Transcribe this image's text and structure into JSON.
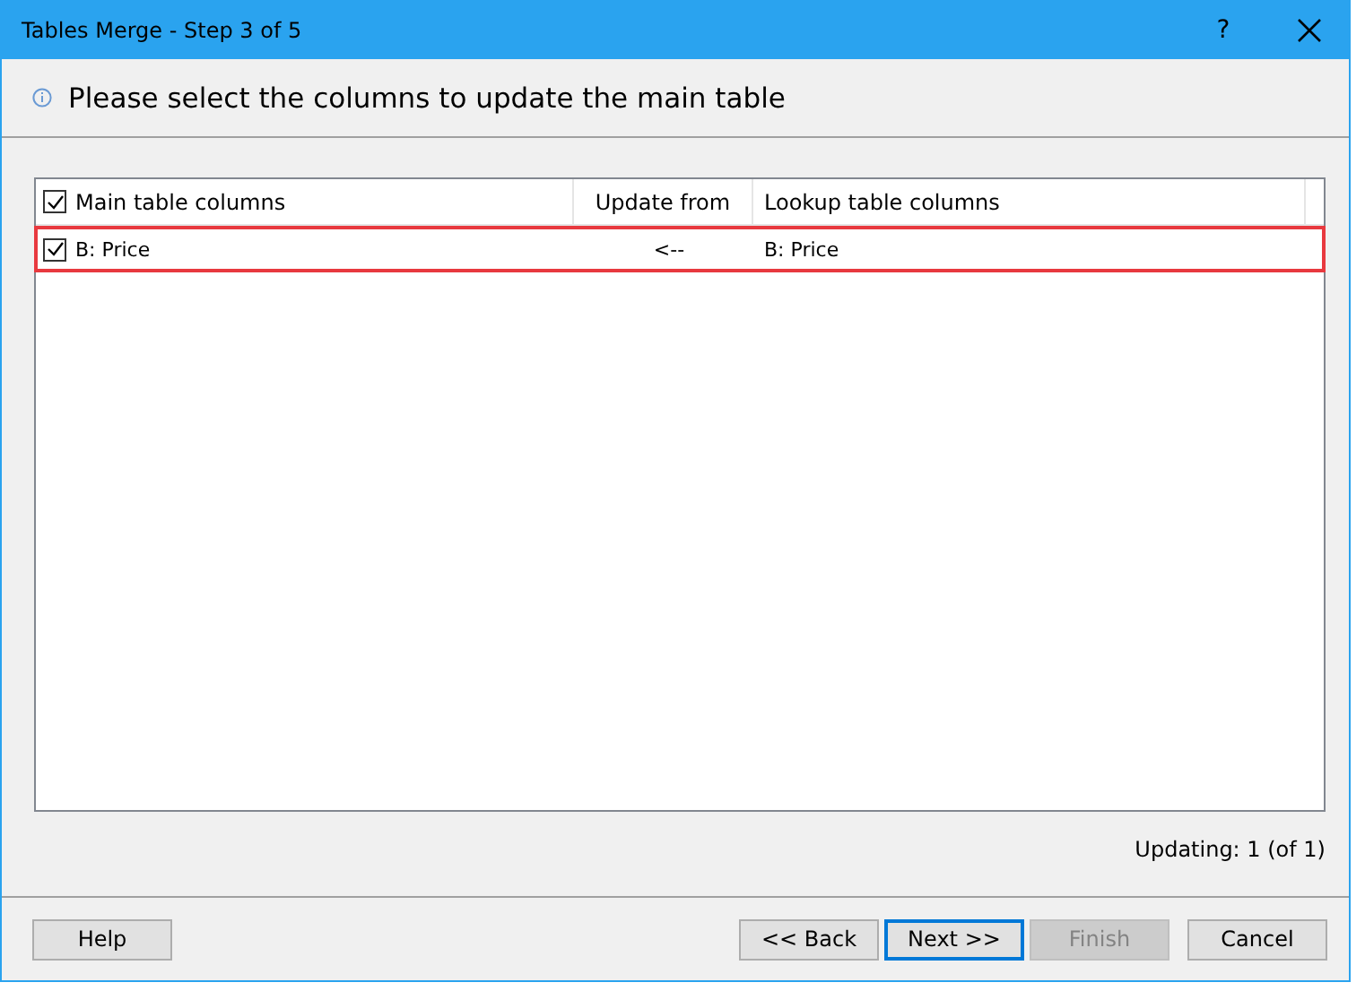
{
  "window": {
    "title": "Tables Merge - Step 3 of 5",
    "help": "?"
  },
  "instruction": "Please select the columns to update the main table",
  "table": {
    "header_checked": true,
    "columns": [
      "Main table columns",
      "Update from",
      "Lookup table columns"
    ],
    "rows": [
      {
        "checked": true,
        "highlighted": true,
        "cells": [
          "B: Price",
          "<--",
          "B: Price"
        ]
      }
    ]
  },
  "status": "Updating: 1 (of 1)",
  "footer": {
    "left_buttons": [
      {
        "label": "Help",
        "disabled": false,
        "focused": false
      }
    ],
    "right_buttons": [
      {
        "label": "<< Back",
        "disabled": false,
        "focused": false
      },
      {
        "label": "Next >>",
        "disabled": false,
        "focused": true
      },
      {
        "label": "Finish",
        "disabled": true,
        "focused": false
      },
      {
        "label": "Cancel",
        "disabled": false,
        "focused": false
      }
    ]
  }
}
